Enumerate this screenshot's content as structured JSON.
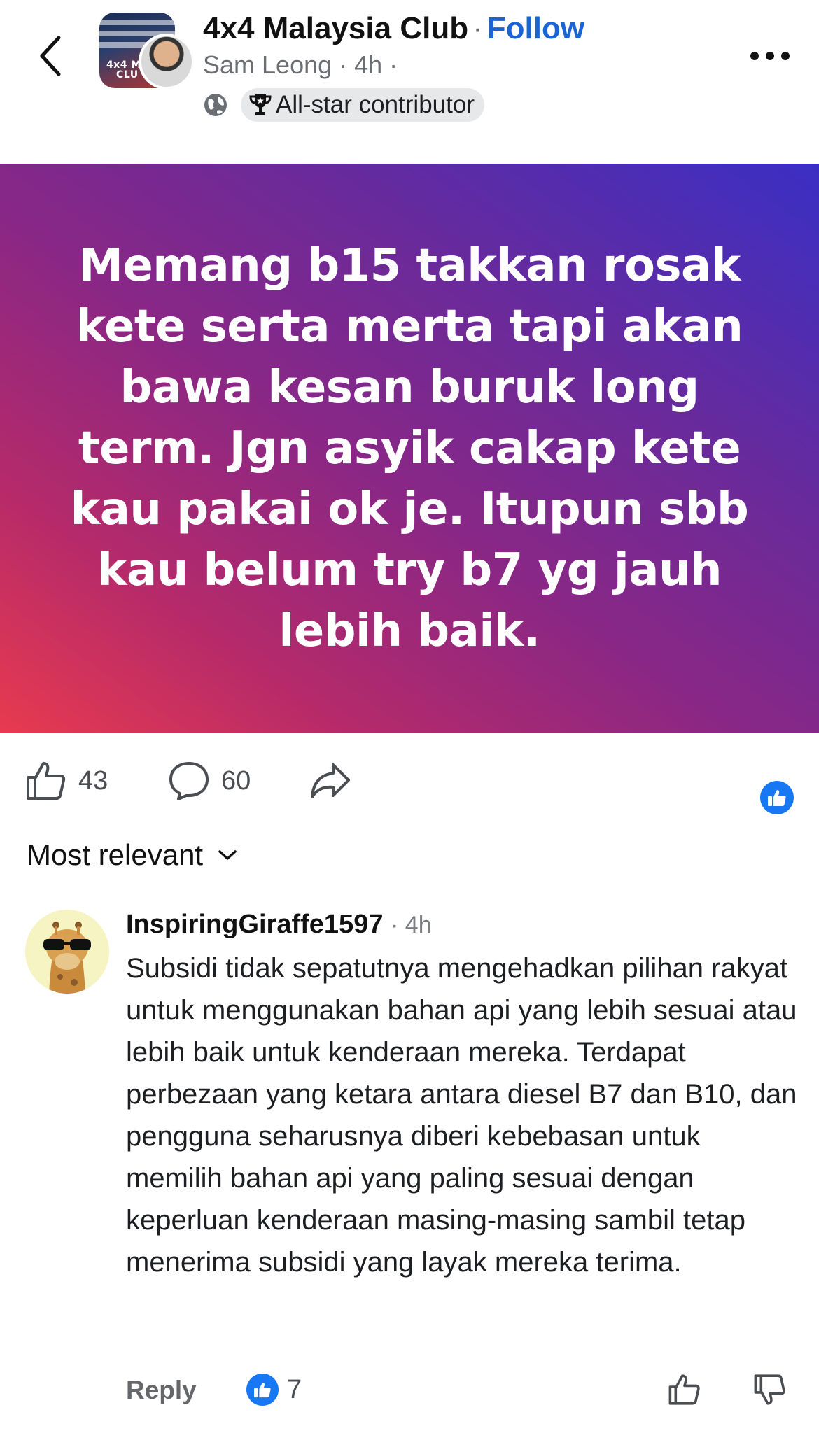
{
  "header": {
    "group_name": "4x4 Malaysia Club",
    "separator": "·",
    "follow_label": "Follow",
    "author_meta": "Sam Leong · 4h ·",
    "badge_label": "All-star contributor",
    "group_avatar_text_line1": "4x4 MAL",
    "group_avatar_text_line2": "CLU",
    "icons": [
      "chevron-left-icon",
      "globe-icon",
      "trophy-icon",
      "more-dots-icon"
    ]
  },
  "post": {
    "text": "Memang b15 takkan rosak kete serta merta tapi akan bawa kesan buruk long term. Jgn asyik cakap kete kau pakai ok je. Itupun sbb kau belum try b7 yg jauh lebih baik.",
    "background_colors": [
      "#e83a4f",
      "#8a2785",
      "#3a2fc4"
    ]
  },
  "actions": {
    "like_count": "43",
    "comment_count": "60",
    "accent": "#1877f2"
  },
  "sort": {
    "label": "Most relevant"
  },
  "comment": {
    "author": "InspiringGiraffe1597",
    "time": "· 4h",
    "body": "Subsidi tidak sepatutnya mengehadkan pilihan rakyat untuk menggunakan bahan api yang lebih sesuai atau lebih baik untuk kenderaan mereka. Terdapat perbezaan yang ketara antara diesel B7 dan B10, dan pengguna seharusnya diberi kebebasan untuk memilih bahan api yang paling sesuai dengan keperluan kenderaan masing-masing sambil tetap menerima subsidi yang layak mereka terima.",
    "reply_label": "Reply",
    "like_count": "7"
  }
}
